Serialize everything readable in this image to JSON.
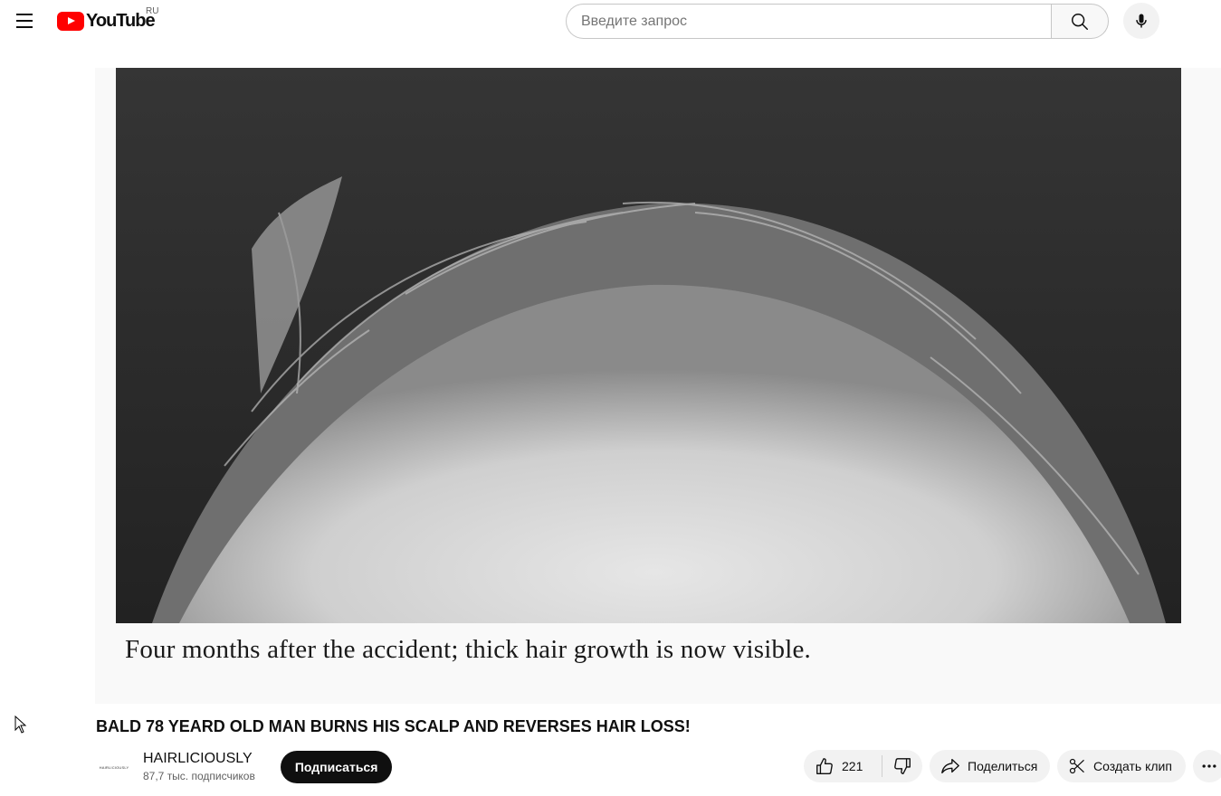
{
  "header": {
    "logo_text": "YouTube",
    "region": "RU",
    "search_placeholder": "Введите запрос"
  },
  "video": {
    "caption": "Four months after the accident; thick hair growth is now visible.",
    "title": "BALD 78 YEARD OLD MAN BURNS HIS SCALP AND REVERSES HAIR LOSS!"
  },
  "channel": {
    "name": "HAIRLICIOUSLY",
    "subscribers": "87,7 тыс. подписчиков",
    "avatar_text": "HAIRLICIOUSLY",
    "subscribe_label": "Подписаться"
  },
  "actions": {
    "likes": "221",
    "share_label": "Поделиться",
    "clip_label": "Создать клип"
  },
  "icons": {
    "menu": "hamburger-menu-icon",
    "search": "search-icon",
    "mic": "microphone-icon",
    "like": "thumbs-up-icon",
    "dislike": "thumbs-down-icon",
    "share": "share-arrow-icon",
    "clip": "scissors-icon",
    "more": "more-horizontal-icon"
  },
  "colors": {
    "brand": "#ff0000",
    "subscribe_bg": "#0f0f0f",
    "pill_bg": "#f2f2f2"
  }
}
